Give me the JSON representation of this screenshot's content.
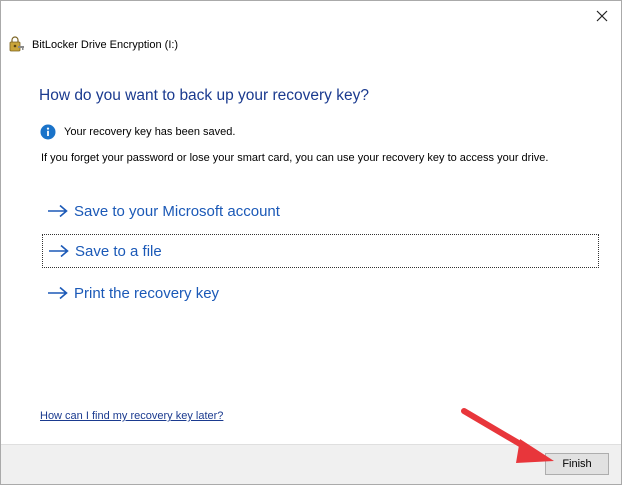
{
  "window": {
    "title": "BitLocker Drive Encryption (I:)",
    "close_label": "✕"
  },
  "main": {
    "heading": "How do you want to back up your recovery key?",
    "saved_message": "Your recovery key has been saved.",
    "description": "If you forget your password or lose your smart card, you can use your recovery key to access your drive.",
    "options": [
      {
        "label": "Save to your Microsoft account"
      },
      {
        "label": "Save to a file"
      },
      {
        "label": "Print the recovery key"
      }
    ],
    "help_link": "How can I find my recovery key later?"
  },
  "footer": {
    "finish_label": "Finish"
  },
  "colors": {
    "heading": "#1a3a8f",
    "option_link": "#1b59b7",
    "annotation_arrow": "#e8363b",
    "info_icon": "#1a73c9"
  },
  "icons": {
    "app": "bitlocker-key-icon",
    "info": "info-icon",
    "option_arrow": "right-arrow-icon",
    "close": "close-icon"
  }
}
